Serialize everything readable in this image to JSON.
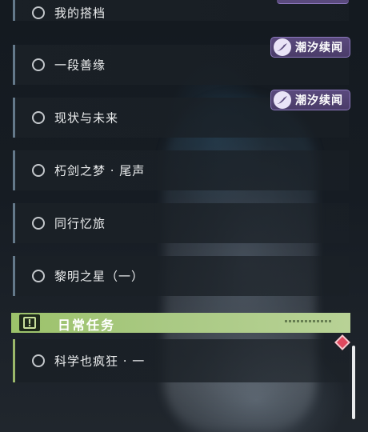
{
  "quests": [
    {
      "label": "我的搭档"
    },
    {
      "label": "一段善缘"
    },
    {
      "label": "现状与未来"
    },
    {
      "label": "朽剑之梦 · 尾声"
    },
    {
      "label": "同行忆旅"
    },
    {
      "label": "黎明之星（一）"
    }
  ],
  "tags": [
    {
      "label": "潮汐续闻",
      "icon": "tide-feather-icon"
    },
    {
      "label": "潮汐续闻",
      "icon": "tide-feather-icon"
    }
  ],
  "daily_section": {
    "title": "日常任务",
    "icon": "exclamation-icon",
    "quests": [
      {
        "label": "科学也疯狂 · 一"
      }
    ]
  },
  "colors": {
    "row_bar": "#64798a",
    "daily_accent": "#9cc26a",
    "tag_bg": "#5a4a7d",
    "alert_diamond": "#e0485e"
  }
}
